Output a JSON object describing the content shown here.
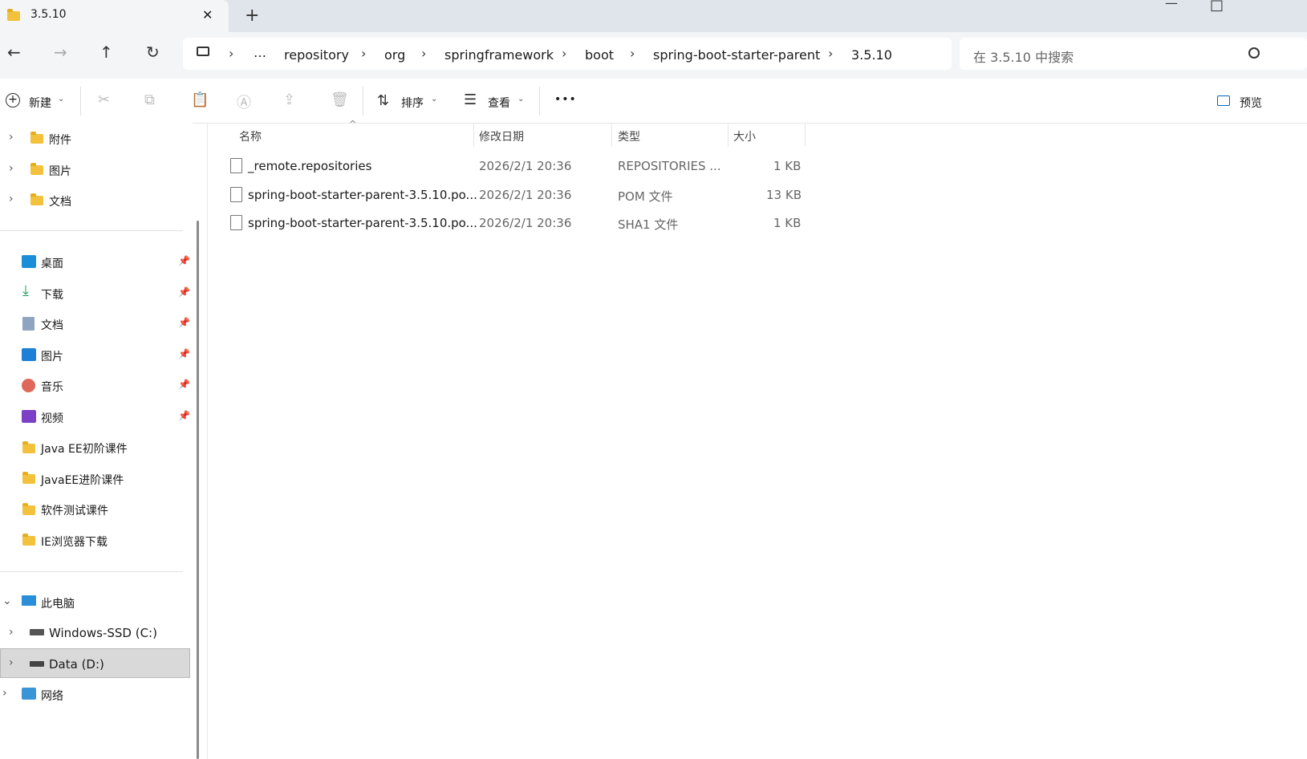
{
  "window": {
    "tab_title": "3.5.10",
    "close_tab": "✕",
    "new_tab": "+",
    "minimize": "—",
    "maximize": "□"
  },
  "address": {
    "crumbs": [
      "…",
      "repository",
      "org",
      "springframework",
      "boot",
      "spring-boot-starter-parent",
      "3.5.10"
    ],
    "search_placeholder": "在 3.5.10 中搜索"
  },
  "toolbar": {
    "new_label": "新建",
    "sort_label": "排序",
    "view_label": "查看",
    "more_label": "•••",
    "preview_label": "预览"
  },
  "sidebar": {
    "top_items": [
      "附件",
      "图片",
      "文档"
    ],
    "quick_access": [
      "桌面",
      "下载",
      "文档",
      "图片",
      "音乐",
      "视频"
    ],
    "folders": [
      "Java EE初阶课件",
      "JavaEE进阶课件",
      "软件测试课件",
      "IE浏览器下载"
    ],
    "this_pc": "此电脑",
    "drives": [
      "Windows-SSD (C:)",
      "Data (D:)"
    ],
    "network": "网络"
  },
  "columns": {
    "name": "名称",
    "modified": "修改日期",
    "type": "类型",
    "size": "大小"
  },
  "files": [
    {
      "name": "_remote.repositories",
      "modified": "2026/2/1 20:36",
      "type": "REPOSITORIES ...",
      "size": "1 KB"
    },
    {
      "name": "spring-boot-starter-parent-3.5.10.po...",
      "modified": "2026/2/1 20:36",
      "type": "POM 文件",
      "size": "13 KB"
    },
    {
      "name": "spring-boot-starter-parent-3.5.10.po...",
      "modified": "2026/2/1 20:36",
      "type": "SHA1 文件",
      "size": "1 KB"
    }
  ],
  "colors": {
    "accent": "#0067c0",
    "folder": "#f2c23c",
    "selection": "#d9d9d9"
  }
}
